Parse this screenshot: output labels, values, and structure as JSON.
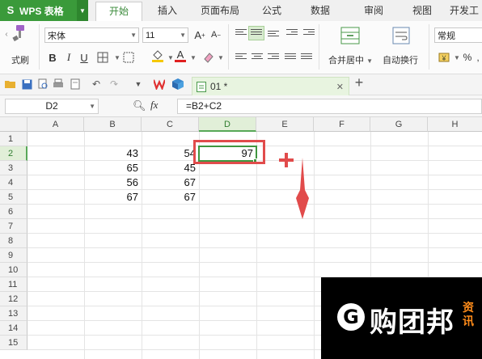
{
  "app": {
    "name": "WPS 表格",
    "logo_letter": "S"
  },
  "menu": {
    "tabs": [
      "开始",
      "插入",
      "页面布局",
      "公式",
      "数据",
      "审阅",
      "视图",
      "开发工"
    ],
    "active": "开始"
  },
  "ribbon": {
    "format_painter_label": "式刷",
    "font_name": "宋体",
    "font_size": "11",
    "merge_center_label": "合并居中",
    "wrap_text_label": "自动换行",
    "number_format": "常规",
    "percent_symbol": "%",
    "comma_symbol": ","
  },
  "document": {
    "tab_name": "01 *"
  },
  "formula_bar": {
    "name_box": "D2",
    "fx": "fx",
    "formula": "=B2+C2"
  },
  "sheet": {
    "columns": [
      "A",
      "B",
      "C",
      "D",
      "E",
      "F",
      "G",
      "H"
    ],
    "rows": [
      "1",
      "2",
      "3",
      "4",
      "5",
      "6",
      "7",
      "8",
      "9",
      "10",
      "11",
      "12",
      "13",
      "14",
      "15"
    ],
    "cells": {
      "B2": "43",
      "C2": "54",
      "D2": "97",
      "B3": "65",
      "C3": "45",
      "B4": "56",
      "C4": "67",
      "B5": "67",
      "C5": "67"
    },
    "selected_cell": "D2"
  },
  "annotation": {
    "plus_symbol": "+",
    "accent_color": "#e14b4b"
  },
  "watermark": {
    "logo_letter": "G",
    "brand": "购团邦",
    "side_text": "资讯"
  },
  "colors": {
    "brand_green": "#3a9a3a",
    "selection_green": "#3f963f"
  }
}
